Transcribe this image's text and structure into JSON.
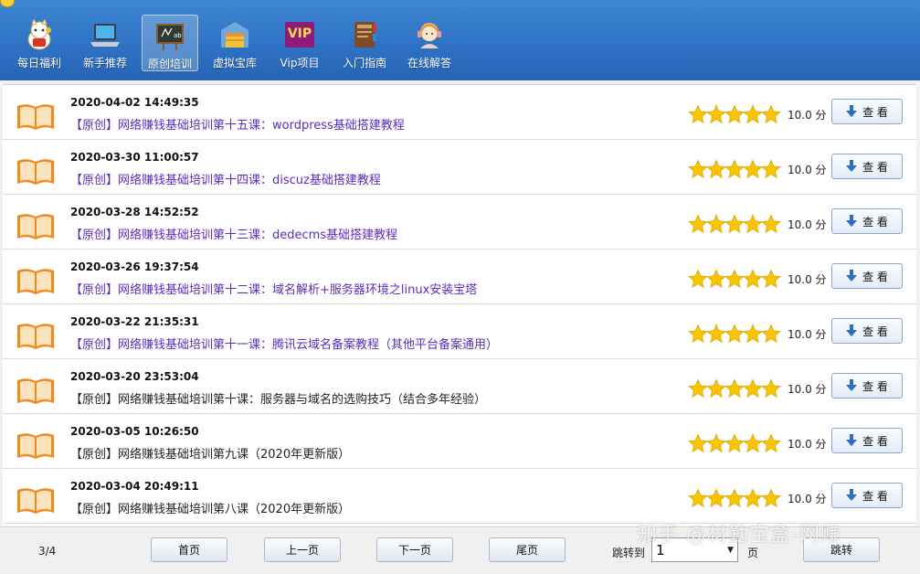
{
  "toolbar": {
    "items": [
      {
        "label": "每日福利",
        "icon": "lucky-cat-icon"
      },
      {
        "label": "新手推荐",
        "icon": "laptop-icon"
      },
      {
        "label": "原创培训",
        "icon": "blackboard-icon",
        "active": true
      },
      {
        "label": "虚拟宝库",
        "icon": "warehouse-icon"
      },
      {
        "label": "Vip项目",
        "icon": "vip-icon",
        "icon_text": "VIP"
      },
      {
        "label": "入门指南",
        "icon": "guide-book-icon"
      },
      {
        "label": "在线解答",
        "icon": "support-agent-icon"
      }
    ]
  },
  "colors": {
    "toolbar_bg": "#2f73c4",
    "link_purple": "#5b2bc0",
    "text_dark": "#222222",
    "star": "#f8c400",
    "book": "#f08a1d"
  },
  "rows": [
    {
      "date": "2020-04-02 14:49:35",
      "title": "【原创】网络赚钱基础培训第十五课：wordpress基础搭建教程",
      "visited": true,
      "rating": 5,
      "score": "10.0 分",
      "button": "查 看"
    },
    {
      "date": "2020-03-30 11:00:57",
      "title": "【原创】网络赚钱基础培训第十四课：discuz基础搭建教程",
      "visited": true,
      "rating": 5,
      "score": "10.0 分",
      "button": "查 看"
    },
    {
      "date": "2020-03-28 14:52:52",
      "title": "【原创】网络赚钱基础培训第十三课：dedecms基础搭建教程",
      "visited": true,
      "rating": 5,
      "score": "10.0 分",
      "button": "查 看"
    },
    {
      "date": "2020-03-26 19:37:54",
      "title": "【原创】网络赚钱基础培训第十二课：域名解析+服务器环境之linux安装宝塔",
      "visited": true,
      "rating": 5,
      "score": "10.0 分",
      "button": "查 看"
    },
    {
      "date": "2020-03-22 21:35:31",
      "title": "【原创】网络赚钱基础培训第十一课：腾讯云域名备案教程（其他平台备案通用）",
      "visited": true,
      "rating": 5,
      "score": "10.0 分",
      "button": "查 看"
    },
    {
      "date": "2020-03-20 23:53:04",
      "title": "【原创】网络赚钱基础培训第十课：服务器与域名的选购技巧（结合多年经验）",
      "visited": false,
      "rating": 5,
      "score": "10.0 分",
      "button": "查 看"
    },
    {
      "date": "2020-03-05 10:26:50",
      "title": "【原创】网络赚钱基础培训第九课（2020年更新版）",
      "visited": false,
      "rating": 5,
      "score": "10.0 分",
      "button": "查 看"
    },
    {
      "date": "2020-03-04 20:49:11",
      "title": "【原创】网络赚钱基础培训第八课（2020年更新版）",
      "visited": false,
      "rating": 5,
      "score": "10.0 分",
      "button": "查 看"
    }
  ],
  "pagination": {
    "indicator": "3/4",
    "first": "首页",
    "prev": "上一页",
    "next": "下一页",
    "last": "尾页",
    "jump_label": "跳转到",
    "selected_page": "1",
    "suffix": "页",
    "go": "跳转"
  },
  "watermark": "知乎 @材勤宝盒-网赚"
}
